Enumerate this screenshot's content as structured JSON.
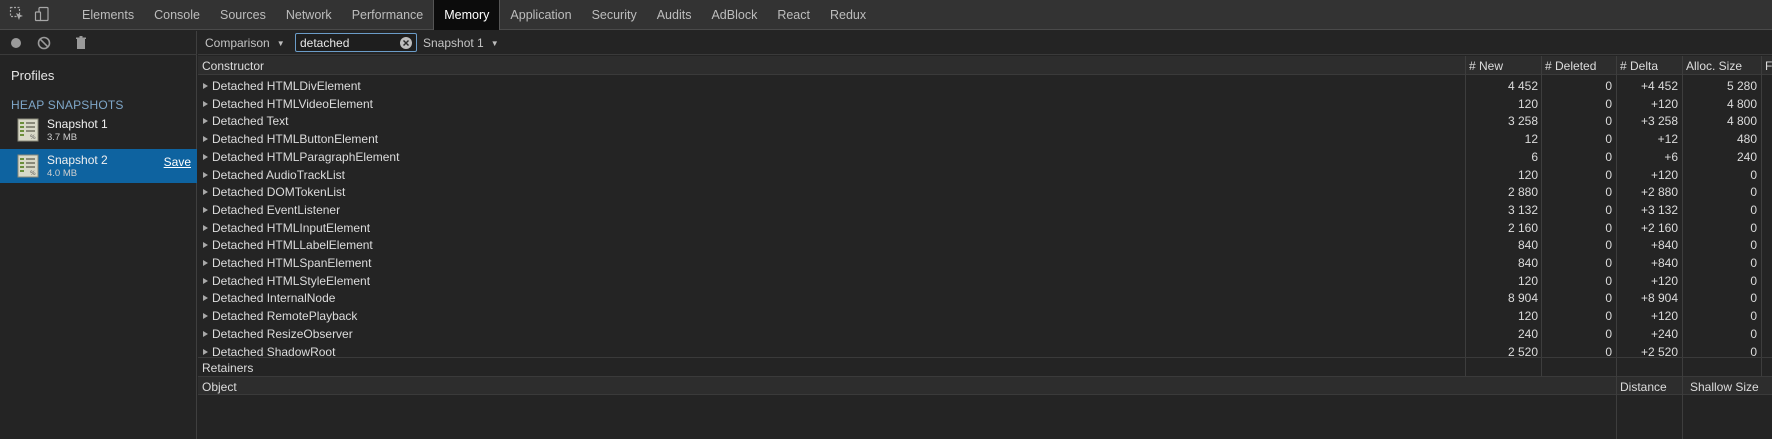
{
  "tabs": [
    "Elements",
    "Console",
    "Sources",
    "Network",
    "Performance",
    "Memory",
    "Application",
    "Security",
    "Audits",
    "AdBlock",
    "React",
    "Redux"
  ],
  "active_tab": "Memory",
  "sidebar": {
    "profiles_title": "Profiles",
    "heap_snapshots_title": "HEAP SNAPSHOTS",
    "snapshots": [
      {
        "name": "Snapshot 1",
        "size": "3.7 MB",
        "selected": false
      },
      {
        "name": "Snapshot 2",
        "size": "4.0 MB",
        "selected": true,
        "save_label": "Save"
      }
    ]
  },
  "toolbar": {
    "view_mode": "Comparison",
    "filter_value": "detached",
    "base_snapshot": "Snapshot 1"
  },
  "table": {
    "headers": {
      "constructor": "Constructor",
      "new": "# New",
      "deleted": "# Deleted",
      "delta": "# Delta",
      "alloc": "Alloc. Size",
      "freed": "Fr"
    },
    "rows": [
      {
        "constructor": "Detached HTMLDivElement",
        "new": "4 452",
        "deleted": "0",
        "delta": "+4 452",
        "alloc": "5 280"
      },
      {
        "constructor": "Detached HTMLVideoElement",
        "new": "120",
        "deleted": "0",
        "delta": "+120",
        "alloc": "4 800"
      },
      {
        "constructor": "Detached Text",
        "new": "3 258",
        "deleted": "0",
        "delta": "+3 258",
        "alloc": "4 800"
      },
      {
        "constructor": "Detached HTMLButtonElement",
        "new": "12",
        "deleted": "0",
        "delta": "+12",
        "alloc": "480"
      },
      {
        "constructor": "Detached HTMLParagraphElement",
        "new": "6",
        "deleted": "0",
        "delta": "+6",
        "alloc": "240"
      },
      {
        "constructor": "Detached AudioTrackList",
        "new": "120",
        "deleted": "0",
        "delta": "+120",
        "alloc": "0"
      },
      {
        "constructor": "Detached DOMTokenList",
        "new": "2 880",
        "deleted": "0",
        "delta": "+2 880",
        "alloc": "0"
      },
      {
        "constructor": "Detached EventListener",
        "new": "3 132",
        "deleted": "0",
        "delta": "+3 132",
        "alloc": "0"
      },
      {
        "constructor": "Detached HTMLInputElement",
        "new": "2 160",
        "deleted": "0",
        "delta": "+2 160",
        "alloc": "0"
      },
      {
        "constructor": "Detached HTMLLabelElement",
        "new": "840",
        "deleted": "0",
        "delta": "+840",
        "alloc": "0"
      },
      {
        "constructor": "Detached HTMLSpanElement",
        "new": "840",
        "deleted": "0",
        "delta": "+840",
        "alloc": "0"
      },
      {
        "constructor": "Detached HTMLStyleElement",
        "new": "120",
        "deleted": "0",
        "delta": "+120",
        "alloc": "0"
      },
      {
        "constructor": "Detached InternalNode",
        "new": "8 904",
        "deleted": "0",
        "delta": "+8 904",
        "alloc": "0"
      },
      {
        "constructor": "Detached RemotePlayback",
        "new": "120",
        "deleted": "0",
        "delta": "+120",
        "alloc": "0"
      },
      {
        "constructor": "Detached ResizeObserver",
        "new": "240",
        "deleted": "0",
        "delta": "+240",
        "alloc": "0"
      },
      {
        "constructor": "Detached ShadowRoot",
        "new": "2 520",
        "deleted": "0",
        "delta": "+2 520",
        "alloc": "0"
      }
    ]
  },
  "retainers": {
    "title": "Retainers",
    "headers": {
      "object": "Object",
      "distance": "Distance",
      "shallow": "Shallow Size"
    }
  },
  "colors": {
    "selected": "#0e63a0",
    "active_tab_bg": "#0c0c0c",
    "panel_bg": "#242424",
    "filter_border": "#6b9cc8"
  }
}
